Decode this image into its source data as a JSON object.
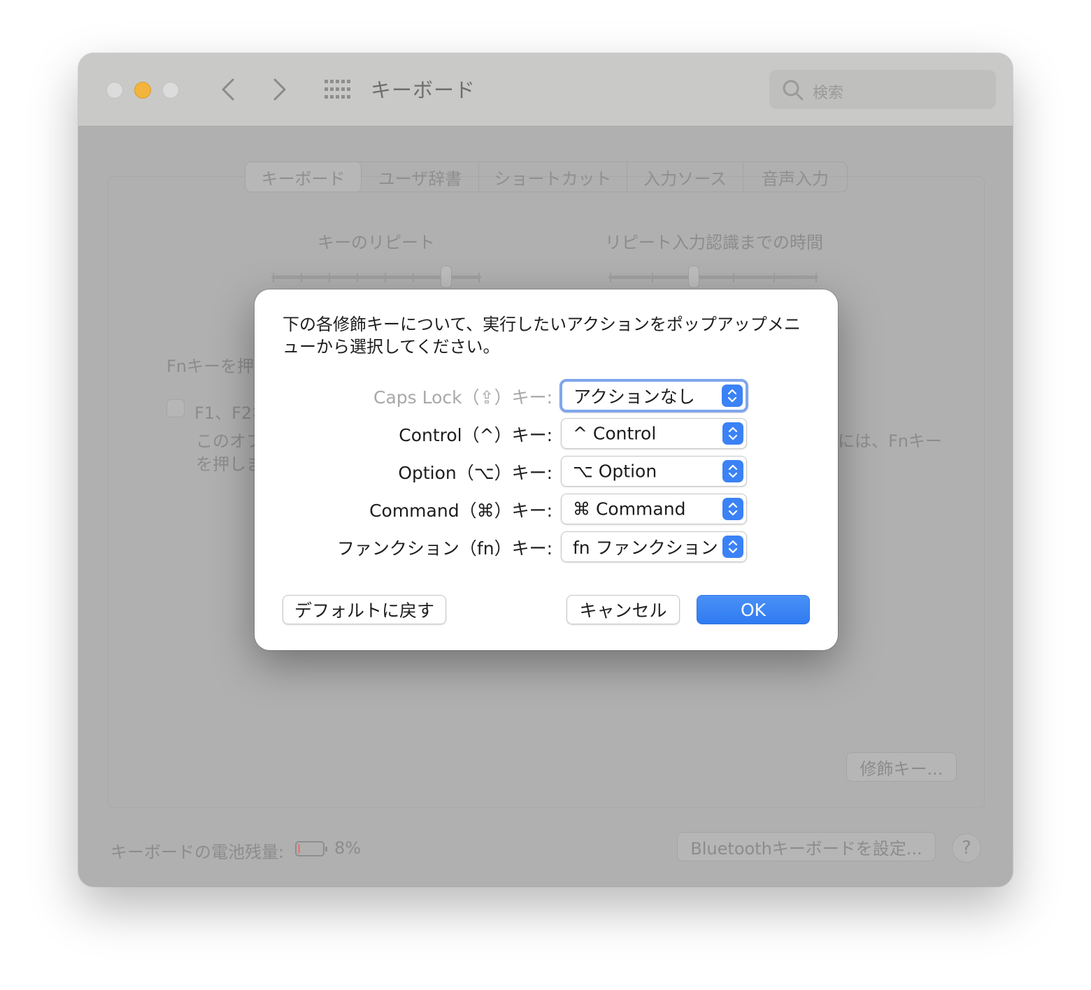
{
  "window": {
    "title": "キーボード",
    "search_placeholder": "検索"
  },
  "tabs": [
    {
      "label": "キーボード",
      "active": true
    },
    {
      "label": "ユーザ辞書",
      "active": false
    },
    {
      "label": "ショートカット",
      "active": false
    },
    {
      "label": "入力ソース",
      "active": false
    },
    {
      "label": "音声入力",
      "active": false
    }
  ],
  "background": {
    "key_repeat_label": "キーのリピート",
    "delay_label": "リピート入力認識までの時間",
    "fn_label_partial": "Fnキーを押",
    "checkbox_label_partial": "F1、F2な",
    "desc_line1_partial": "このオプ",
    "desc_line2_partial": "を押しま",
    "desc_right_partial": "には、Fnキー",
    "modifier_button": "修飾キー...",
    "battery_label": "キーボードの電池残量:",
    "battery_percent": "8%",
    "battery_level": 0.08,
    "bluetooth_button": "Bluetoothキーボードを設定...",
    "help_button": "?"
  },
  "dialog": {
    "message": "下の各修飾キーについて、実行したいアクションをポップアップメニューから選択してください。",
    "rows": [
      {
        "label": "Caps Lock（⇪）キー:",
        "value": "アクションなし",
        "enabled": false,
        "focused": true
      },
      {
        "label": "Control（^）キー:",
        "value": "^ Control",
        "enabled": true,
        "focused": false
      },
      {
        "label": "Option（⌥）キー:",
        "value": "⌥ Option",
        "enabled": true,
        "focused": false
      },
      {
        "label": "Command（⌘）キー:",
        "value": "⌘ Command",
        "enabled": true,
        "focused": false
      },
      {
        "label": "ファンクション（fn）キー:",
        "value": "fn ファンクション",
        "enabled": true,
        "focused": false
      }
    ],
    "restore_defaults_button": "デフォルトに戻す",
    "cancel_button": "キャンセル",
    "ok_button": "OK"
  },
  "colors": {
    "accent": "#3b82f6",
    "focus_ring": "#7fa6ec",
    "minimize_light": "#f2b43c"
  }
}
